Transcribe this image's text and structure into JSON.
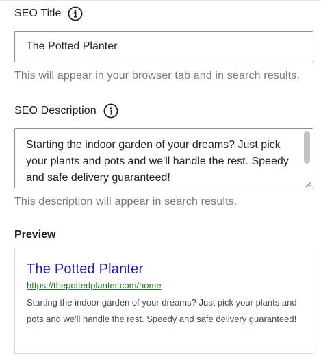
{
  "seo_title": {
    "label": "SEO Title",
    "info_icon": "info-icon",
    "value": "The Potted Planter",
    "hint": "This will appear in your browser tab and in search results."
  },
  "seo_description": {
    "label": "SEO Description",
    "info_icon": "info-icon",
    "value": "Starting the indoor garden of your dreams? Just pick your plants and pots and we'll handle the rest. Speedy and safe delivery guaranteed!",
    "hint": "This description will appear in search results."
  },
  "preview": {
    "label": "Preview",
    "title": "The Potted Planter",
    "url": "https://thepottedplanter.com/home",
    "description": "Starting the indoor garden of your dreams? Just pick your plants and pots and we'll handle the rest. Speedy and safe delivery guaranteed!"
  },
  "colors": {
    "preview_title": "#1a1ab8",
    "preview_url": "#1f7a1f",
    "hint_text": "#7a7a7a",
    "field_border": "#8e8e8e"
  }
}
